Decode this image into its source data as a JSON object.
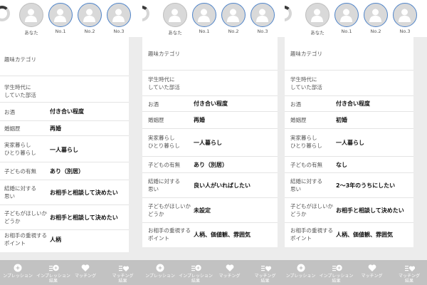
{
  "header": {
    "avatars": [
      "あなた",
      "No.1",
      "No.2",
      "No.3"
    ]
  },
  "labels": {
    "hobby": "趣味カテゴリ",
    "club_1": "学生時代に",
    "club_2": "していた部活",
    "alcohol": "お酒",
    "marriage": "婚姻歴",
    "living_1": "実家暮らし",
    "living_2": "ひとり暮らし",
    "children": "子どもの有無",
    "thoughts_1": "結婚に対する",
    "thoughts_2": "思い",
    "want_1": "子どもがほしいか",
    "want_2": "どうか",
    "priority_1": "お相手の重視する",
    "priority_2": "ポイント"
  },
  "profiles": [
    {
      "alcohol": "付き合い程度",
      "marriage": "再婚",
      "living": "一人暮らし",
      "children": "あり（別居）",
      "thoughts": "お相手と相談して決めたい",
      "want_children": "お相手と相談して決めたい",
      "priority": "人柄"
    },
    {
      "alcohol": "付き合い程度",
      "marriage": "再婚",
      "living": "一人暮らし",
      "children": "あり（別居）",
      "thoughts": "良い人がいればしたい",
      "want_children": "未設定",
      "priority": "人柄、価値観、雰囲気"
    },
    {
      "alcohol": "付き合い程度",
      "marriage": "初婚",
      "living": "一人暮らし",
      "children": "なし",
      "thoughts": "2〜3年のうちにしたい",
      "want_children": "お相手と相談して決めたい",
      "priority": "人柄、価値観、雰囲気"
    }
  ],
  "tabs": [
    {
      "label": "ンプレッション",
      "icon": "sparkle-icon"
    },
    {
      "label": "インプレッション",
      "label2": "結果",
      "icon": "list-sparkle-icon"
    },
    {
      "label": "マッチング",
      "icon": "heart-icon"
    },
    {
      "label": "マッチング",
      "label2": "結果",
      "icon": "list-heart-icon"
    },
    {
      "label": "ンプレッション",
      "icon": "sparkle-icon"
    },
    {
      "label": "インプレッション",
      "label2": "結果",
      "icon": "list-sparkle-icon"
    },
    {
      "label": "マッチング",
      "icon": "heart-icon"
    },
    {
      "label": "マッチング",
      "label2": "結果",
      "icon": "list-heart-icon"
    },
    {
      "label": "ンプレッション",
      "icon": "sparkle-icon"
    },
    {
      "label": "インプレッション",
      "label2": "結果",
      "icon": "list-sparkle-icon"
    },
    {
      "label": "マッチング",
      "icon": "heart-icon"
    },
    {
      "label": "マッチング",
      "label2": "結果",
      "icon": "list-heart-icon"
    }
  ]
}
